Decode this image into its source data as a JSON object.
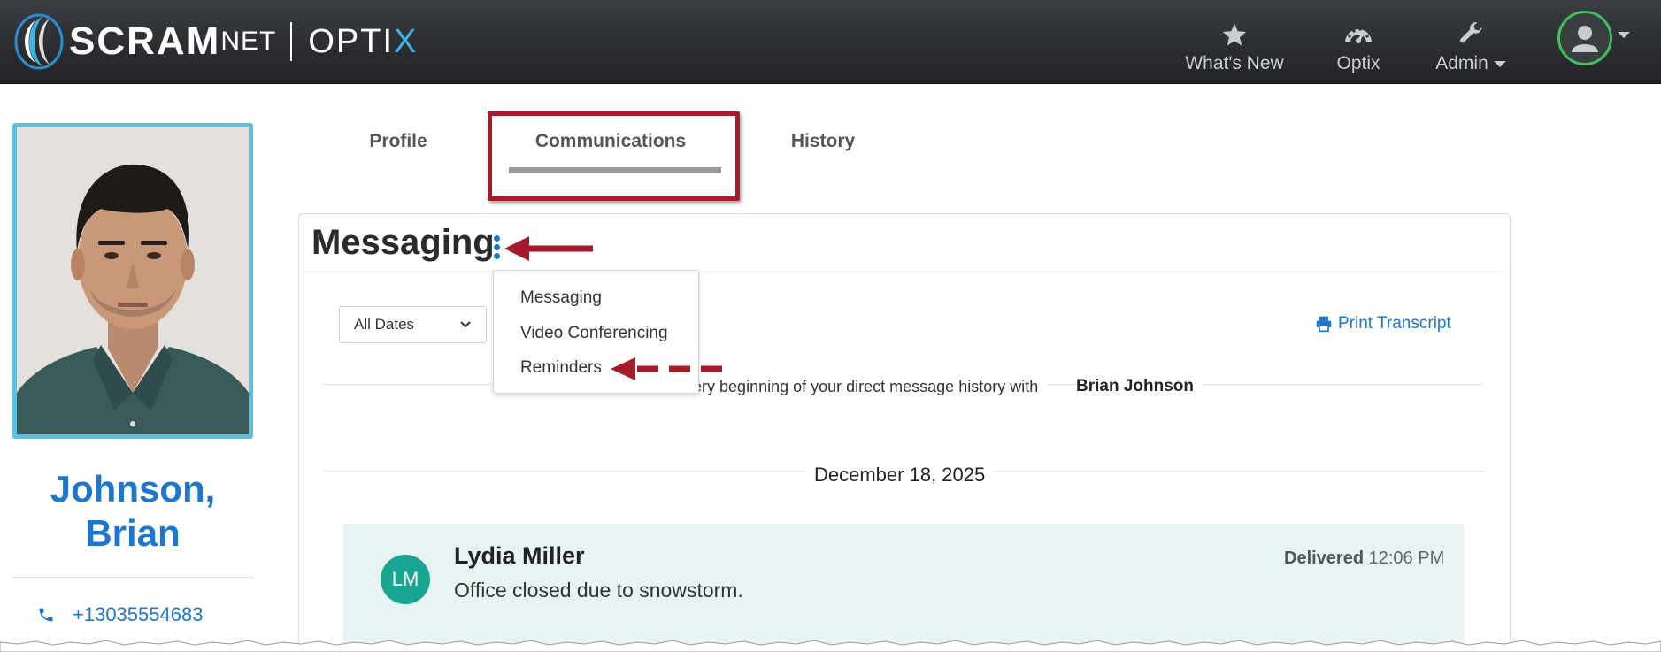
{
  "header": {
    "brand_scram": "SCRAM",
    "brand_net": "NET",
    "brand_optix": "OPTI",
    "brand_optix_x": "X",
    "nav": [
      {
        "label": "What's New",
        "icon": "star-icon"
      },
      {
        "label": "Optix",
        "icon": "dashboard-gauge-icon"
      },
      {
        "label": "Admin",
        "icon": "wrench-icon"
      }
    ],
    "avatar_icon": "user-avatar-icon"
  },
  "left_panel": {
    "name_line1": "Johnson,",
    "name_line2": "Brian",
    "phone": "+13035554683",
    "phone_icon": "phone-icon"
  },
  "tabs": [
    {
      "label": "Profile",
      "active": false
    },
    {
      "label": "Communications",
      "active": true
    },
    {
      "label": "History",
      "active": false
    }
  ],
  "messaging": {
    "title": "Messaging",
    "date_filter": "All Dates",
    "print_label": "Print Transcript",
    "history_text": "This is the very beginning of your direct message history with",
    "history_name": "Brian Johnson",
    "day_label": "December 18, 2025",
    "menu_items": [
      "Messaging",
      "Video Conferencing",
      "Reminders"
    ],
    "message": {
      "initials": "LM",
      "sender": "Lydia Miller",
      "body": "Office closed due to snowstorm.",
      "status": "Delivered",
      "time": "12:06 PM"
    }
  },
  "colors": {
    "accent_blue": "#1c77cf",
    "callout_red": "#a61b2b",
    "avatar_teal": "#1aa592",
    "message_bg": "#e8f4f3",
    "online_green": "#3fc05a"
  }
}
